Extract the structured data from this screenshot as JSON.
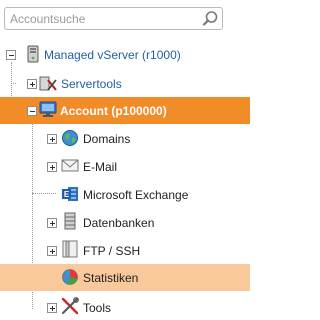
{
  "search": {
    "placeholder": "Accountsuche",
    "value": ""
  },
  "tree": {
    "root": {
      "label": "Managed vServer (r1000)",
      "icon": "server-icon"
    },
    "servertools": {
      "label": "Servertools",
      "icon": "servertools-icon"
    },
    "account": {
      "label": "Account (p100000)",
      "icon": "monitor-icon"
    },
    "children": [
      {
        "label": "Domains",
        "icon": "globe-icon",
        "expandable": true
      },
      {
        "label": "E-Mail",
        "icon": "envelope-icon",
        "expandable": true
      },
      {
        "label": "Microsoft Exchange",
        "icon": "exchange-icon",
        "expandable": false
      },
      {
        "label": "Datenbanken",
        "icon": "database-icon",
        "expandable": true
      },
      {
        "label": "FTP / SSH",
        "icon": "ftp-icon",
        "expandable": true
      },
      {
        "label": "Statistiken",
        "icon": "pie-chart-icon",
        "expandable": false
      }
    ],
    "tools": {
      "label": "Tools",
      "icon": "tools-icon"
    }
  },
  "colors": {
    "selected": "#f28c28",
    "hover": "#f9c99c",
    "link": "#1f5fa8"
  }
}
